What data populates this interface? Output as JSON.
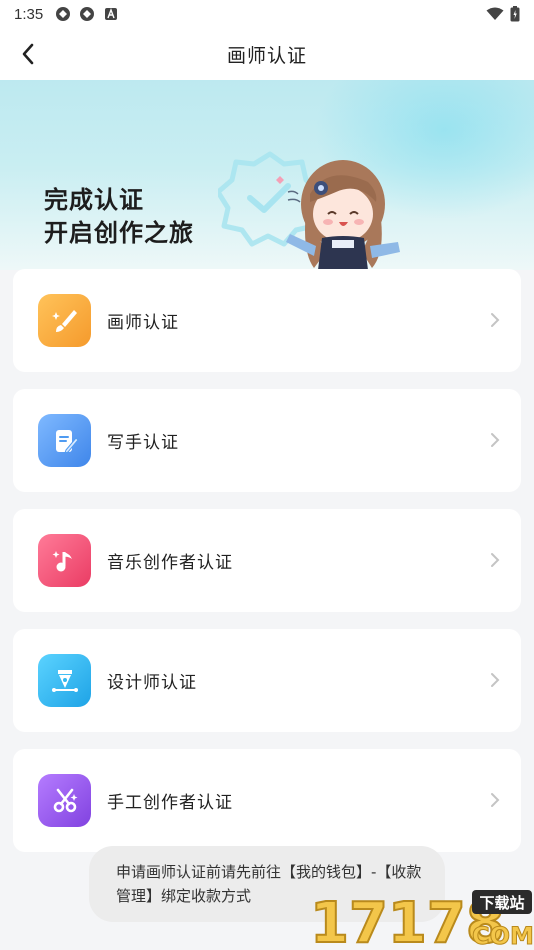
{
  "status_bar": {
    "time": "1:35",
    "icons": [
      "app-notification-icon",
      "app-notification-icon",
      "accessibility-icon",
      "wifi-icon",
      "battery-icon"
    ]
  },
  "nav": {
    "back_icon": "back-arrow-icon",
    "title": "画师认证"
  },
  "banner": {
    "line1": "完成认证",
    "line2": "开启创作之旅"
  },
  "cards": [
    {
      "label": "画师认证",
      "icon": "paintbrush-icon",
      "color": "#f8a93a"
    },
    {
      "label": "写手认证",
      "icon": "notepad-pen-icon",
      "color": "#4f9bf1"
    },
    {
      "label": "音乐创作者认证",
      "icon": "music-note-icon",
      "color": "#f0577a"
    },
    {
      "label": "设计师认证",
      "icon": "pen-nib-icon",
      "color": "#34b8ef"
    },
    {
      "label": "手工创作者认证",
      "icon": "scissors-icon",
      "color": "#9656e8"
    }
  ],
  "toast": {
    "text": "申请画师认证前请先前往【我的钱包】-【收款管理】绑定收款方式"
  },
  "watermark": {
    "brand": "17178",
    "tag": "下载站",
    "suffix": "COM"
  }
}
